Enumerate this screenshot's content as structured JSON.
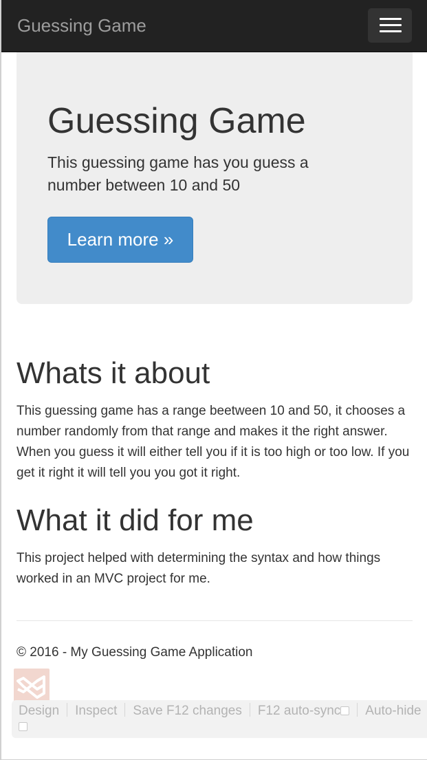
{
  "navbar": {
    "brand": "Guessing Game",
    "toggle_icon": "hamburger-icon"
  },
  "jumbotron": {
    "title": "Guessing Game",
    "lead": "This guessing game has you guess a number between 10 and 50",
    "button_label": "Learn more »",
    "button_color": "#428bca"
  },
  "sections": [
    {
      "title": "Whats it about",
      "text": "This guessing game has a range beetween 10 and 50, it chooses a number randomly from that range and makes it the right answer. When you guess it will either tell you if it is too high or too low. If you get it right it will tell you you got it right."
    },
    {
      "title": "What it did for me",
      "text": "This project helped with determining the syntax and how things worked in an MVC project for me."
    }
  ],
  "footer": {
    "text": "© 2016 - My Guessing Game Application"
  },
  "browser_link_toolbar": {
    "logo_icon": "visual-studio-icon",
    "items": [
      "Design",
      "Inspect",
      "Save F12 changes",
      "F12 auto-sync",
      "Auto-hide"
    ]
  }
}
